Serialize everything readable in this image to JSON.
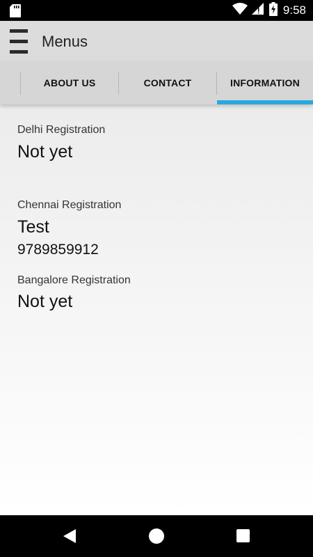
{
  "status_bar": {
    "time": "9:58",
    "icons": [
      "sd-card-icon",
      "wifi-icon",
      "signal-icon",
      "battery-icon"
    ]
  },
  "app_bar": {
    "title": "Menus",
    "menu_icon": "hamburger-menu-icon"
  },
  "tabs": [
    {
      "label": "ABOUT US",
      "selected": false
    },
    {
      "label": "CONTACT",
      "selected": false
    },
    {
      "label": "INFORMATION",
      "selected": true
    }
  ],
  "accent_color": "#29a8e0",
  "registrations": [
    {
      "label": "Delhi Registration",
      "value": "Not yet"
    },
    {
      "label": "Chennai Registration",
      "value": "Test",
      "phone": "9789859912"
    },
    {
      "label": "Bangalore Registration",
      "value": "Not yet"
    }
  ],
  "nav_bar": {
    "buttons": [
      "back-icon",
      "home-icon",
      "recent-apps-icon"
    ]
  }
}
